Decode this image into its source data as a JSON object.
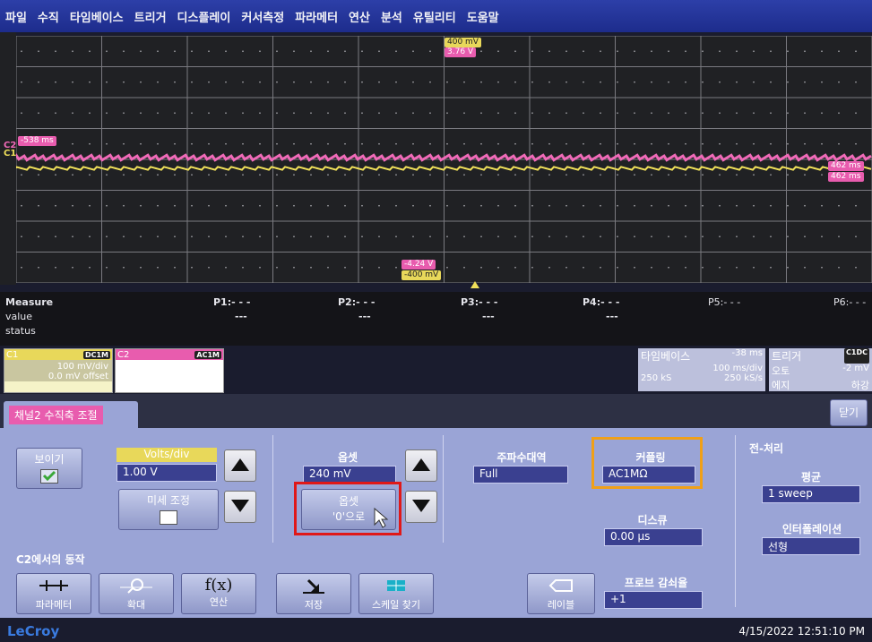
{
  "menu": [
    "파일",
    "수직",
    "타임베이스",
    "트리거",
    "디스플레이",
    "커서측정",
    "파라메터",
    "연산",
    "분석",
    "유틸리티",
    "도움말"
  ],
  "waveform": {
    "marker_top_1": "400 mV",
    "marker_top_2": "3.76 V",
    "marker_left": "-538 ms",
    "marker_right_1": "462 ms",
    "marker_right_2": "462 ms",
    "marker_bottom_1": "-4.24 V",
    "marker_bottom_2": "-400 mV",
    "ch_label_c2": "C2",
    "ch_label_c1": "C1",
    "colors": {
      "c1": "#f0e05a",
      "c2": "#f06ab8"
    }
  },
  "measure": {
    "title": "Measure",
    "row_value": "value",
    "row_status": "status",
    "params": [
      "P1:- - -",
      "P2:- - -",
      "P3:- - -",
      "P4:- - -",
      "P5:- - -",
      "P6:- - -"
    ],
    "values": [
      "---",
      "---",
      "---",
      "---"
    ]
  },
  "channels": {
    "c1": {
      "name": "C1",
      "badge": "DC1M",
      "vdiv": "100 mV/div",
      "offset": "0.0 mV offset"
    },
    "c2": {
      "name": "C2",
      "badge": "AC1M"
    }
  },
  "timebase": {
    "title": "타임베이스",
    "delay": "-38 ms",
    "tdiv": "100 ms/div",
    "samples": "250 kS",
    "rate": "250 kS/s"
  },
  "trigger": {
    "title": "트리거",
    "badge": "C1DC",
    "mode": "오토",
    "level": "-2 mV",
    "type": "에지",
    "slope": "하강"
  },
  "panel": {
    "tab": "채널2 수직축 조절",
    "close": "닫기",
    "show_label": "보이기",
    "volts_div_label": "Volts/div",
    "volts_div_value": "1.00 V",
    "fine_adjust": "미세 조정",
    "offset_label": "옵셋",
    "offset_value": "240 mV",
    "offset_zero_1": "옵셋",
    "offset_zero_2": "'0'으로",
    "bandwidth_label": "주파수대역",
    "bandwidth_value": "Full",
    "coupling_label": "커플링",
    "coupling_value": "AC1MΩ",
    "deskew_label": "디스큐",
    "deskew_value": "0.00 µs",
    "probe_label": "프로브 감쇠율",
    "probe_value": "+1",
    "preproc_label": "전-처리",
    "average_label": "평균",
    "average_value": "1 sweep",
    "interp_label": "인터폴레이션",
    "interp_value": "선형",
    "actions_label": "C2에서의 동작",
    "actions": [
      "파라메터",
      "확대",
      "연산",
      "저장",
      "스케일 찾기"
    ],
    "label_btn": "레이블"
  },
  "footer": {
    "logo": "LeCroy",
    "datetime": "4/15/2022 12:51:10 PM"
  }
}
